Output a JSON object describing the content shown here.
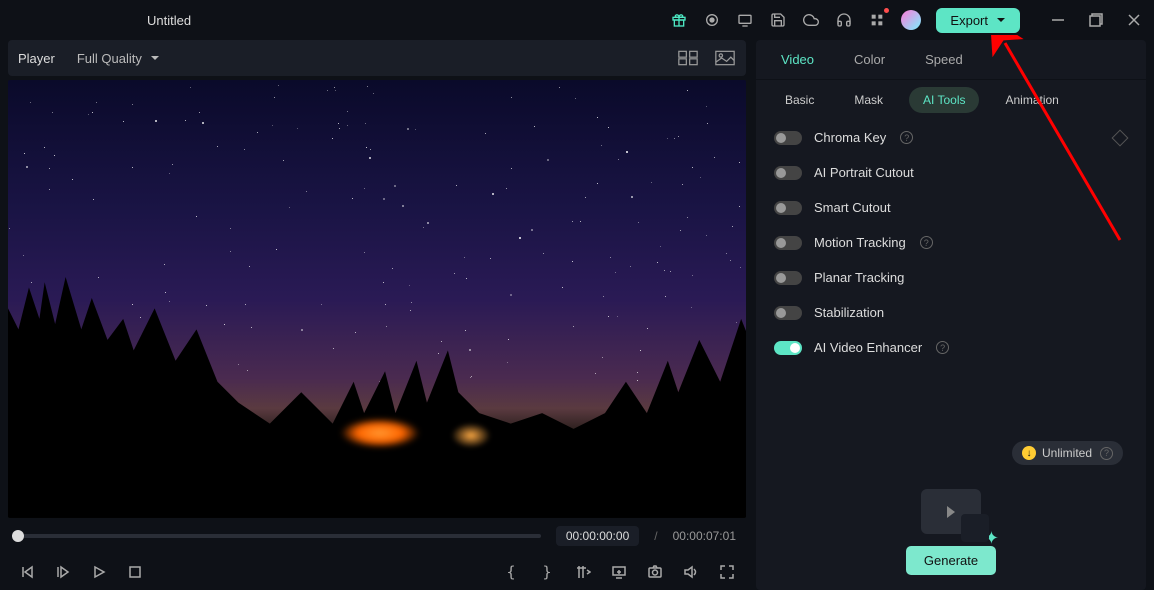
{
  "title": "Untitled",
  "export_label": "Export",
  "player": {
    "label": "Player",
    "quality": "Full Quality"
  },
  "time": {
    "current": "00:00:00:00",
    "separator": "/",
    "total": "00:00:07:01"
  },
  "prop_tabs": [
    "Video",
    "Color",
    "Speed"
  ],
  "prop_tab_active": 0,
  "sub_tabs": [
    "Basic",
    "Mask",
    "AI Tools",
    "Animation"
  ],
  "sub_tab_active": 2,
  "ai_tools": [
    {
      "label": "Chroma Key",
      "on": false,
      "help": true
    },
    {
      "label": "AI Portrait Cutout",
      "on": false,
      "help": false
    },
    {
      "label": "Smart Cutout",
      "on": false,
      "help": false
    },
    {
      "label": "Motion Tracking",
      "on": false,
      "help": true
    },
    {
      "label": "Planar Tracking",
      "on": false,
      "help": false
    },
    {
      "label": "Stabilization",
      "on": false,
      "help": false
    },
    {
      "label": "AI Video Enhancer",
      "on": true,
      "help": true
    }
  ],
  "unlimited_label": "Unlimited",
  "generate_label": "Generate",
  "icons": {
    "brace_open": "{",
    "brace_close": "}"
  }
}
